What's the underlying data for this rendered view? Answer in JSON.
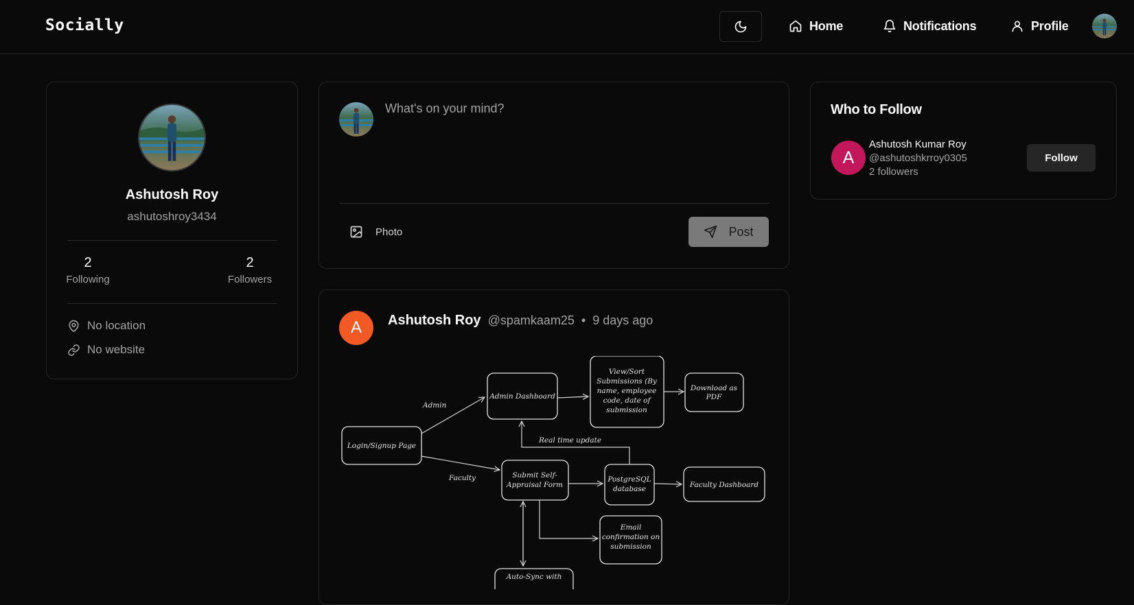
{
  "nav": {
    "brand": "Socially",
    "theme_icon": "moon-icon",
    "home_label": "Home",
    "notifications_label": "Notifications",
    "profile_label": "Profile"
  },
  "profile": {
    "name": "Ashutosh Roy",
    "username": "ashutoshroy3434",
    "following_count": "2",
    "following_label": "Following",
    "followers_count": "2",
    "followers_label": "Followers",
    "location": "No location",
    "website": "No website"
  },
  "compose": {
    "placeholder": "What's on your mind?",
    "photo_label": "Photo",
    "post_label": "Post"
  },
  "post": {
    "avatar_initial": "A",
    "author": "Ashutosh Roy",
    "handle": "@spamkaam25",
    "separator": "•",
    "time": "9 days ago",
    "diagram": {
      "login": "Login/Signup Page",
      "admin_edge": "Admin",
      "faculty_edge": "Faculty",
      "admin_dashboard": "Admin Dashboard",
      "view_sort": [
        "View/Sort",
        "Submissions (By",
        "name, employee",
        "code, date of",
        "submission"
      ],
      "download_pdf": [
        "Download as",
        "PDF"
      ],
      "realtime": "Real time update",
      "submit_form": [
        "Submit Self-",
        "Appraisal Form"
      ],
      "postgres": [
        "PostgreSQL",
        "database"
      ],
      "faculty_dashboard": "Faculty Dashboard",
      "email": [
        "Email",
        "confirmation on",
        "submission"
      ],
      "autosync": "Auto-Sync with"
    }
  },
  "who_to_follow": {
    "title": "Who to Follow",
    "suggestions": [
      {
        "initial": "A",
        "name": "Ashutosh Kumar Roy",
        "handle": "@ashutoshkrroy0305",
        "followers": "2 followers",
        "button": "Follow"
      }
    ]
  },
  "colors": {
    "background": "#0a0a0a",
    "border": "#262626",
    "post_avatar": "#f15a24",
    "follow_avatar": "#c2185b"
  }
}
